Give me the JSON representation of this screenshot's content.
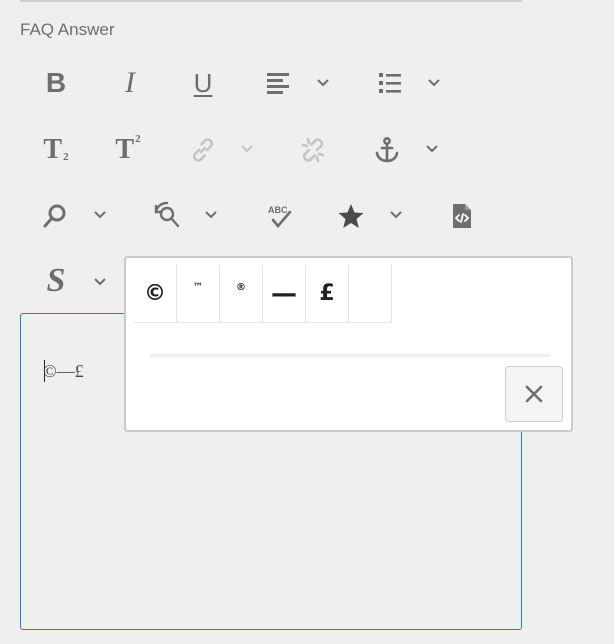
{
  "field": {
    "label": "FAQ Answer"
  },
  "toolbar": {
    "bold": "B",
    "italic": "I",
    "underline": "U",
    "subscript_T": "T",
    "subscript_n": "2",
    "superscript_T": "T",
    "superscript_n": "2",
    "spellcheck_label": "ABC",
    "strike_s": "S"
  },
  "editor": {
    "content": "©—£"
  },
  "special_chars_popup": {
    "chars": [
      "©",
      "™",
      "®",
      "—",
      "£",
      ""
    ]
  },
  "colors": {
    "accent": "#3d72d7",
    "icon": "#6e6e6e",
    "icon_disabled": "#c4c4c4",
    "background": "#efefef"
  },
  "icons": [
    "align-icon",
    "list-icon",
    "link-icon",
    "unlink-icon",
    "anchor-icon",
    "find-icon",
    "find-replace-icon",
    "spellcheck-icon",
    "star-icon",
    "source-code-icon",
    "close-icon",
    "chevron-down-icon"
  ]
}
